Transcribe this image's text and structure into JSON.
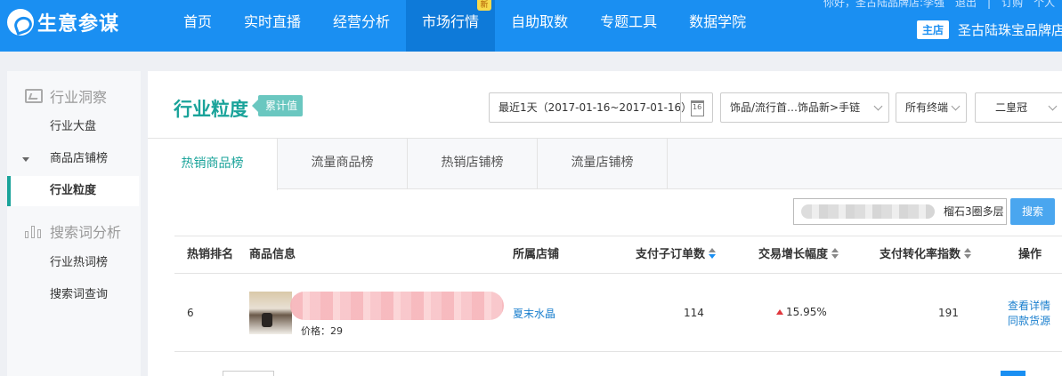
{
  "topbar": {
    "logo": "生意参谋",
    "nav": [
      "首页",
      "实时直播",
      "经营分析",
      "市场行情",
      "自助取数",
      "专题工具",
      "数据学院"
    ],
    "active_nav": "市场行情",
    "nav_badge": "新",
    "user_line": "你好，圣古陆品牌店:李强　退出　|　订购　个人",
    "shop_tag": "主店",
    "shop_name": "圣古陆珠宝品牌店"
  },
  "sidebar": {
    "group1": "行业洞察",
    "group1_items": [
      "行业大盘",
      "商品店铺榜",
      "行业粒度"
    ],
    "group2": "搜索词分析",
    "group2_items": [
      "行业热词榜",
      "搜索词查询"
    ],
    "active_item": "行业粒度"
  },
  "main": {
    "title": "行业粒度",
    "title_tag": "累计值",
    "date_range": "最近1天（2017-01-16~2017-01-16）",
    "calendar_day": "16",
    "category": "饰品/流行首…饰品新>手链",
    "terminal": "所有终端",
    "level": "二皇冠",
    "tabs": [
      "热销商品榜",
      "流量商品榜",
      "热销店铺榜",
      "流量店铺榜"
    ],
    "active_tab": "热销商品榜",
    "search_value": "榴石3圈多层",
    "search_button": "搜索"
  },
  "table": {
    "headers": [
      "热销排名",
      "商品信息",
      "所属店铺",
      "支付子订单数",
      "交易增长幅度",
      "支付转化率指数",
      "操作"
    ],
    "rows": [
      {
        "rank": "6",
        "price": "价格：29",
        "shop": "夏末水晶",
        "orders": "114",
        "growth": "15.95%",
        "conversion": "191",
        "action1": "查看详情",
        "action2": "同款货源"
      }
    ]
  },
  "colors": {
    "brand_blue": "#1a8ff2",
    "teal_accent": "#1aa39a",
    "growth_red": "#e0383e"
  }
}
